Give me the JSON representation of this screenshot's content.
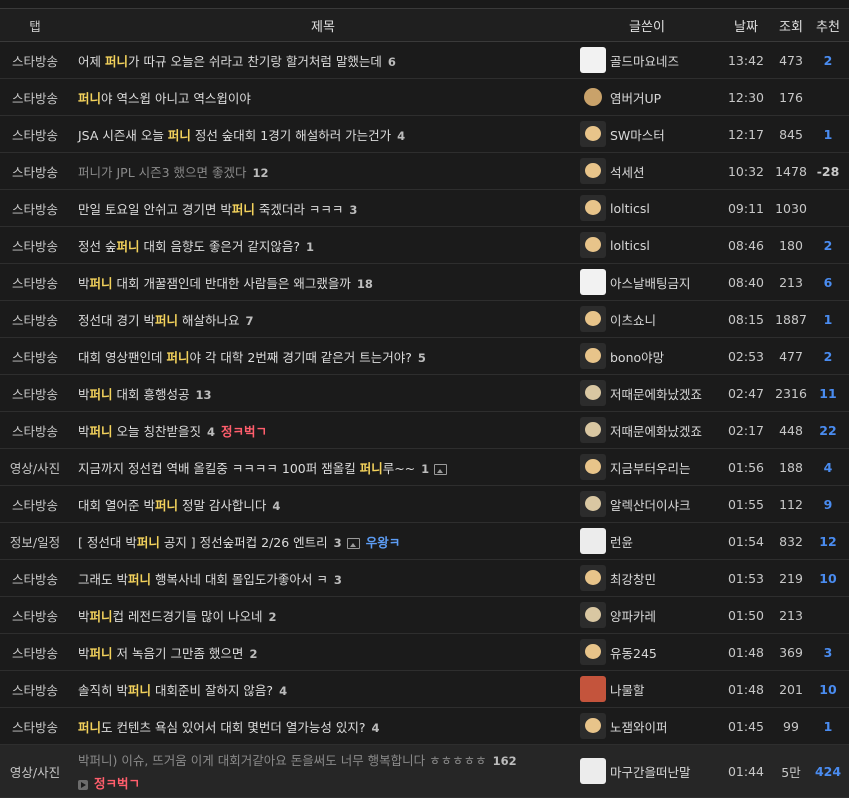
{
  "headers": {
    "tab": "탭",
    "title": "제목",
    "author": "글쓴이",
    "date": "날짜",
    "views": "조회",
    "rec": "추천"
  },
  "rows": [
    {
      "tab": "스타방송",
      "pre": "어제 ",
      "hl": "퍼니",
      "post": "가 따규 오늘은 쉬라고 찬기랑 할거처럼 말했는데",
      "comments": "6",
      "author": "골드마요네즈",
      "avatar": "cat-icon",
      "time": "13:42",
      "views": "473",
      "rec": "2"
    },
    {
      "tab": "스타방송",
      "pre": "",
      "hl": "퍼니",
      "post": "야 역스윕 아니고 역스윕이야",
      "comments": "",
      "author": "염버거UP",
      "avatar": "round-icon",
      "time": "12:30",
      "views": "176",
      "rec": ""
    },
    {
      "tab": "스타방송",
      "pre": "JSA 시즌새 오늘 ",
      "hl": "퍼니",
      "post": " 정선 숲대회 1경기 해설하러 가는건가",
      "comments": "4",
      "author": "SW마스터",
      "avatar": "dog-icon",
      "time": "12:17",
      "views": "845",
      "rec": "1"
    },
    {
      "tab": "스타방송",
      "pre": "퍼니가 JPL 시즌3 했으면 좋겠다",
      "hl": "",
      "post": "",
      "comments": "12",
      "author": "석세션",
      "avatar": "dog-icon",
      "time": "10:32",
      "views": "1478",
      "rec": "-28",
      "dim": true
    },
    {
      "tab": "스타방송",
      "pre": "만일 토요일 안쉬고 경기면 박",
      "hl": "퍼니",
      "post": " 죽겠더라 ㅋㅋㅋ",
      "comments": "3",
      "author": "lolticsl",
      "avatar": "dog-icon",
      "time": "09:11",
      "views": "1030",
      "rec": ""
    },
    {
      "tab": "스타방송",
      "pre": "정선 숲",
      "hl": "퍼니",
      "post": " 대회 음향도 좋은거 같지않음?",
      "comments": "1",
      "author": "lolticsl",
      "avatar": "dog-icon",
      "time": "08:46",
      "views": "180",
      "rec": "2"
    },
    {
      "tab": "스타방송",
      "pre": "박",
      "hl": "퍼니",
      "post": " 대회 개꿀잼인데 반대한 사람들은 왜그랬을까",
      "comments": "18",
      "author": "아스날배팅금지",
      "avatar": "cat-icon",
      "time": "08:40",
      "views": "213",
      "rec": "6"
    },
    {
      "tab": "스타방송",
      "pre": "정선대 경기 박",
      "hl": "퍼니",
      "post": " 해살하나요",
      "comments": "7",
      "author": "이츠쇼니",
      "avatar": "dog-icon",
      "time": "08:15",
      "views": "1887",
      "rec": "1"
    },
    {
      "tab": "스타방송",
      "pre": "대회 영상팬인데 ",
      "hl": "퍼니",
      "post": "야 각 대학 2번째 경기때 같은거 트는거야?",
      "comments": "5",
      "author": "bono야망",
      "avatar": "dog-icon",
      "time": "02:53",
      "views": "477",
      "rec": "2"
    },
    {
      "tab": "스타방송",
      "pre": "박",
      "hl": "퍼니",
      "post": " 대회 흥행성공",
      "comments": "13",
      "author": "저때문에화났겠죠",
      "avatar": "dog2-icon",
      "time": "02:47",
      "views": "2316",
      "rec": "11"
    },
    {
      "tab": "스타방송",
      "pre": "박",
      "hl": "퍼니",
      "post": " 오늘 칭찬받을짓",
      "comments": "4",
      "author": "저때문에화났겠죠",
      "avatar": "dog2-icon",
      "time": "02:17",
      "views": "448",
      "rec": "22",
      "badge": "정ㅋ벅ㄱ"
    },
    {
      "tab": "영상/사진",
      "pre": "지금까지 정선컵 역배 올킬중 ㅋㅋㅋㅋ 100퍼 잼올킬 ",
      "hl": "퍼니",
      "post": "루~~",
      "comments": "1",
      "author": "지금부터우리는",
      "avatar": "dog-icon",
      "time": "01:56",
      "views": "188",
      "rec": "4",
      "img": true
    },
    {
      "tab": "스타방송",
      "pre": "대회 열어준 박",
      "hl": "퍼니",
      "post": " 정말 감사합니다",
      "comments": "4",
      "author": "알렉산더이샤크",
      "avatar": "dog2-icon",
      "time": "01:55",
      "views": "112",
      "rec": "9"
    },
    {
      "tab": "정보/일정",
      "pre": "[ 정선대 박",
      "hl": "퍼니",
      "post": " 공지 ] 정선숲퍼컵 2/26 엔트리",
      "comments": "3",
      "author": "런윤",
      "avatar": "bear-icon",
      "time": "01:54",
      "views": "832",
      "rec": "12",
      "img": true,
      "badge": "우왕ㅋ",
      "badgeBlue": true
    },
    {
      "tab": "스타방송",
      "pre": "그래도 박",
      "hl": "퍼니",
      "post": " 행복사네 대회 몰입도가좋아서 ㅋ",
      "comments": "3",
      "author": "최강창민",
      "avatar": "dog-icon",
      "time": "01:53",
      "views": "219",
      "rec": "10"
    },
    {
      "tab": "스타방송",
      "pre": "박",
      "hl": "퍼니",
      "post": "컵 레전드경기들 많이 나오네",
      "comments": "2",
      "author": "양파카레",
      "avatar": "dog2-icon",
      "time": "01:50",
      "views": "213",
      "rec": ""
    },
    {
      "tab": "스타방송",
      "pre": "박",
      "hl": "퍼니",
      "post": " 저 녹음기 그만좀 했으면",
      "comments": "2",
      "author": "유동245",
      "avatar": "dog-icon",
      "time": "01:48",
      "views": "369",
      "rec": "3"
    },
    {
      "tab": "스타방송",
      "pre": "솔직히 박",
      "hl": "퍼니",
      "post": " 대회준비 잘하지 않음?",
      "comments": "4",
      "author": "나물할",
      "avatar": "ram-icon",
      "time": "01:48",
      "views": "201",
      "rec": "10"
    },
    {
      "tab": "스타방송",
      "pre": "",
      "hl": "퍼니",
      "post": "도 컨텐츠 욕심 있어서 대회 몇번더 열가능성 있지?",
      "comments": "4",
      "author": "노잼와이퍼",
      "avatar": "dog-icon",
      "time": "01:45",
      "views": "99",
      "rec": "1"
    },
    {
      "tab": "영상/사진",
      "pre": "박퍼니) 이슈, 뜨거움 이게 대회거같아요 돈을써도 너무 행복합니다 ㅎㅎㅎㅎㅎ",
      "hl": "",
      "post": "",
      "comments": "162",
      "author": "마구간을떠난말",
      "avatar": "bear-icon",
      "time": "01:44",
      "views": "5만",
      "rec": "424",
      "dim": true,
      "tall": true,
      "badge": "정ㅋ벅ㄱ",
      "video": true
    }
  ]
}
